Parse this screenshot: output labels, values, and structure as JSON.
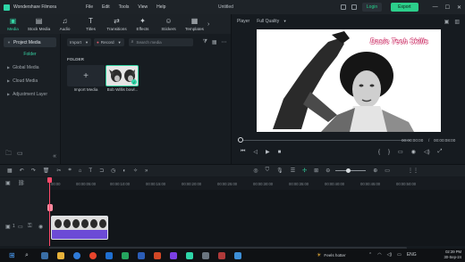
{
  "app": {
    "name": "Wondershare Filmora",
    "menu": [
      "File",
      "Edit",
      "Tools",
      "View",
      "Help"
    ],
    "document_title": "Untitled",
    "login_label": "Login",
    "export_label": "Export"
  },
  "toolbar": {
    "tabs": [
      {
        "label": "Media",
        "icon": "media-icon",
        "glyph": "▣",
        "active": true
      },
      {
        "label": "Stock Media",
        "icon": "stock-media-icon",
        "glyph": "▤",
        "active": false
      },
      {
        "label": "Audio",
        "icon": "audio-icon",
        "glyph": "♫",
        "active": false
      },
      {
        "label": "Titles",
        "icon": "titles-icon",
        "glyph": "T",
        "active": false
      },
      {
        "label": "Transitions",
        "icon": "transitions-icon",
        "glyph": "⇄",
        "active": false
      },
      {
        "label": "Effects",
        "icon": "effects-icon",
        "glyph": "✦",
        "active": false
      },
      {
        "label": "Stickers",
        "icon": "stickers-icon",
        "glyph": "☺",
        "active": false
      },
      {
        "label": "Templates",
        "icon": "templates-icon",
        "glyph": "▦",
        "active": false
      }
    ]
  },
  "sidebar": {
    "project_media": "Project Media",
    "folder": "Folder",
    "global_media": "Global Media",
    "cloud_media": "Cloud Media",
    "adjustment_layer": "Adjustment Layer"
  },
  "library": {
    "import_label": "Import",
    "record_label": "Record",
    "search_placeholder": "Search media",
    "folder_heading": "FOLDER",
    "import_media_label": "Import Media",
    "clip_name": "Bob Willis bowl..."
  },
  "player": {
    "tab_label": "Player",
    "quality": "Full Quality",
    "watermark": "Basic Tech Skills",
    "current_time": "00:00:00:00",
    "total_time": "00:00:08:00"
  },
  "timeline": {
    "ticks": [
      "00:00",
      "00:00:05:00",
      "00:00:10:00",
      "00:00:15:00",
      "00:00:20:00",
      "00:00:25:00",
      "00:00:30:00",
      "00:00:35:00",
      "00:00:40:00",
      "00:00:45:00",
      "00:00:50:00"
    ],
    "track_label": "1"
  },
  "taskbar": {
    "weather": "Feels hotter",
    "time": "02:39 PM",
    "date": "30-Sep-24",
    "lang": "ENG"
  },
  "colors": {
    "accent": "#2ed6a8",
    "playhead": "#ff4a6a",
    "audio_track": "#6c4bd6",
    "export_button": "#2ccf8b"
  }
}
